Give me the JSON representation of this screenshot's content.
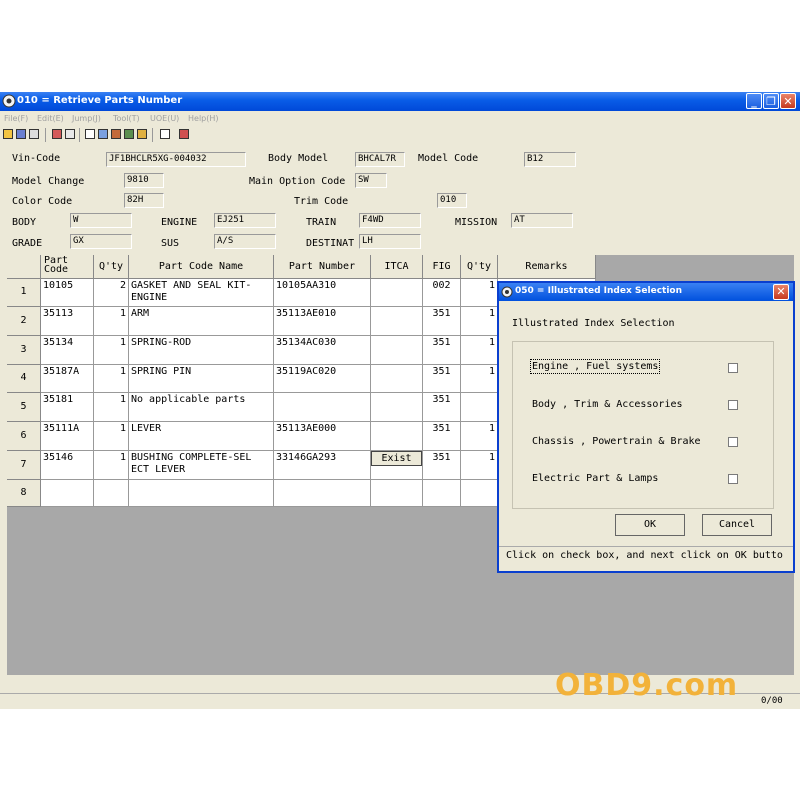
{
  "window": {
    "title": "010 = Retrieve Parts Number"
  },
  "menu": [
    "File(F)",
    "Edit(E)",
    "Jump(J)",
    "Tool(T)",
    "UOE(U)",
    "Help(H)"
  ],
  "header": {
    "vin_code": {
      "label": "Vin-Code",
      "value": "JF1BHCLR5XG-004032"
    },
    "body_model": {
      "label": "Body Model",
      "value": "BHCAL7R"
    },
    "model_code": {
      "label": "Model Code",
      "value": "B12"
    },
    "model_change": {
      "label": "Model Change",
      "value": "9810"
    },
    "main_option_code": {
      "label": "Main Option Code",
      "value": "SW"
    },
    "color_code": {
      "label": "Color Code",
      "value": "82H"
    },
    "trim_code": {
      "label": "Trim Code",
      "value": "010"
    },
    "body": {
      "label": "BODY",
      "value": "W"
    },
    "engine": {
      "label": "ENGINE",
      "value": "EJ251"
    },
    "train": {
      "label": "TRAIN",
      "value": "F4WD"
    },
    "mission": {
      "label": "MISSION",
      "value": "AT"
    },
    "grade": {
      "label": "GRADE",
      "value": "GX"
    },
    "sus": {
      "label": "SUS",
      "value": "A/S"
    },
    "destinat": {
      "label": "DESTINAT",
      "value": "LH"
    }
  },
  "grid": {
    "columns": [
      "Part Code",
      "Q'ty",
      "Part Code Name",
      "Part Number",
      "ITCA",
      "FIG",
      "Q'ty",
      "Remarks"
    ],
    "rows": [
      {
        "no": "1",
        "part_code": "10105",
        "qty": "2",
        "name": "GASKET AND SEAL KIT-\nENGINE",
        "part_number": "10105AA310",
        "itca": "",
        "fig": "002",
        "qty2": "1"
      },
      {
        "no": "2",
        "part_code": "35113",
        "qty": "1",
        "name": "ARM",
        "part_number": "35113AE010",
        "itca": "",
        "fig": "351",
        "qty2": "1"
      },
      {
        "no": "3",
        "part_code": "35134",
        "qty": "1",
        "name": "SPRING-ROD",
        "part_number": "35134AC030",
        "itca": "",
        "fig": "351",
        "qty2": "1"
      },
      {
        "no": "4",
        "part_code": "35187A",
        "qty": "1",
        "name": "SPRING PIN",
        "part_number": "35119AC020",
        "itca": "",
        "fig": "351",
        "qty2": "1"
      },
      {
        "no": "5",
        "part_code": "35181",
        "qty": "1",
        "name": "No applicable parts",
        "part_number": "",
        "itca": "",
        "fig": "351",
        "qty2": ""
      },
      {
        "no": "6",
        "part_code": "35111A",
        "qty": "1",
        "name": "LEVER",
        "part_number": "35113AE000",
        "itca": "",
        "fig": "351",
        "qty2": "1"
      },
      {
        "no": "7",
        "part_code": "35146",
        "qty": "1",
        "name": "BUSHING COMPLETE-SEL\nECT LEVER",
        "part_number": "33146GA293",
        "itca": "Exist",
        "fig": "351",
        "qty2": "1"
      },
      {
        "no": "8",
        "part_code": "",
        "qty": "",
        "name": "",
        "part_number": "",
        "itca": "",
        "fig": "",
        "qty2": ""
      }
    ]
  },
  "dialog": {
    "title": "050 = Illustrated Index Selection",
    "heading": "Illustrated Index Selection",
    "options": [
      {
        "label": "Engine , Fuel systems",
        "checked": false
      },
      {
        "label": "Body , Trim & Accessories",
        "checked": false
      },
      {
        "label": "Chassis , Powertrain & Brake",
        "checked": false
      },
      {
        "label": "Electric Part & Lamps",
        "checked": false
      }
    ],
    "ok_label": "OK",
    "cancel_label": "Cancel",
    "status": "Click on check box, and next click on OK butto"
  },
  "status_bar": {
    "page": "0/00"
  },
  "watermark": "OBD9.com",
  "colors": {
    "titlebar": "#0a5ee8",
    "window_bg": "#ece9d8",
    "watermark": "#f2b23a"
  }
}
